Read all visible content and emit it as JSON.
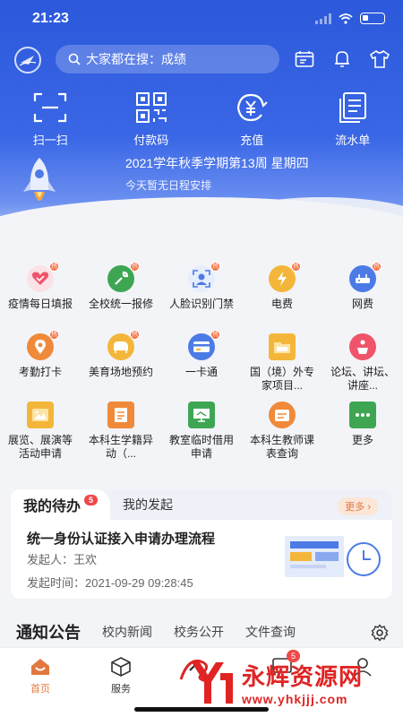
{
  "status": {
    "time": "21:23"
  },
  "search": {
    "placeholder": "大家都在搜：成绩"
  },
  "quick_actions": [
    {
      "label": "扫一扫",
      "icon": "scan-icon"
    },
    {
      "label": "付款码",
      "icon": "qrcode-icon"
    },
    {
      "label": "充值",
      "icon": "yuan-recharge-icon"
    },
    {
      "label": "流水单",
      "icon": "receipt-icon"
    }
  ],
  "schedule": {
    "week": "2021学年秋季学期第13周 星期四",
    "note": "今天暂无日程安排"
  },
  "services": [
    {
      "label": "疫情每日填报",
      "icon": "heart-icon",
      "color": "#f0546a",
      "hot": true
    },
    {
      "label": "全校统一报修",
      "icon": "wrench-icon",
      "color": "#3ea653",
      "hot": true
    },
    {
      "label": "人脸识别门禁",
      "icon": "face-scan-icon",
      "color": "#4c7be6",
      "hot": true
    },
    {
      "label": "电费",
      "icon": "lightning-icon",
      "color": "#f4b63a",
      "hot": true
    },
    {
      "label": "网费",
      "icon": "router-icon",
      "color": "#4c7be6",
      "hot": true
    },
    {
      "label": "考勤打卡",
      "icon": "location-pin-icon",
      "color": "#f08a3a",
      "hot": true
    },
    {
      "label": "美育场地预约",
      "icon": "piano-icon",
      "color": "#f4b63a",
      "hot": true
    },
    {
      "label": "一卡通",
      "icon": "card-icon",
      "color": "#4c7be6",
      "hot": true
    },
    {
      "label": "国（境）外专家项目...",
      "icon": "folder-icon",
      "color": "#f4b63a",
      "hot": false
    },
    {
      "label": "论坛、讲坛、讲座...",
      "icon": "podium-icon",
      "color": "#f0546a",
      "hot": false
    },
    {
      "label": "展览、展演等活动申请",
      "icon": "picture-icon",
      "color": "#f4b63a",
      "hot": false
    },
    {
      "label": "本科生学籍异动（...",
      "icon": "student-record-icon",
      "color": "#f08a3a",
      "hot": false
    },
    {
      "label": "教室临时借用申请",
      "icon": "classroom-icon",
      "color": "#3ea653",
      "hot": false
    },
    {
      "label": "本科生教师课表查询",
      "icon": "schedule-icon",
      "color": "#f08a3a",
      "hot": false
    },
    {
      "label": "更多",
      "icon": "more-icon",
      "color": "#3ea653",
      "hot": false
    }
  ],
  "todo": {
    "tab_active": "我的待办",
    "badge": "5",
    "tab_other": "我的发起",
    "more": "更多 ›",
    "title": "统一身份认证接入申请办理流程",
    "initiator": "发起人：王欢",
    "time": "发起时间：2021-09-29 09:28:45"
  },
  "notice_tabs": {
    "active": "通知公告",
    "tabs": [
      "校内新闻",
      "校务公开",
      "文件查询"
    ]
  },
  "tabbar": [
    {
      "label": "首页",
      "icon": "home-icon",
      "active": true
    },
    {
      "label": "服务",
      "icon": "box-icon",
      "active": false
    },
    {
      "label": "",
      "icon": "center-logo-icon",
      "active": false
    },
    {
      "label": "",
      "icon": "message-icon",
      "active": false,
      "badge": "5"
    },
    {
      "label": "",
      "icon": "user-icon",
      "active": false
    }
  ],
  "watermark": {
    "main": "永辉资源网",
    "sub": "www.yhkjjj.com"
  }
}
